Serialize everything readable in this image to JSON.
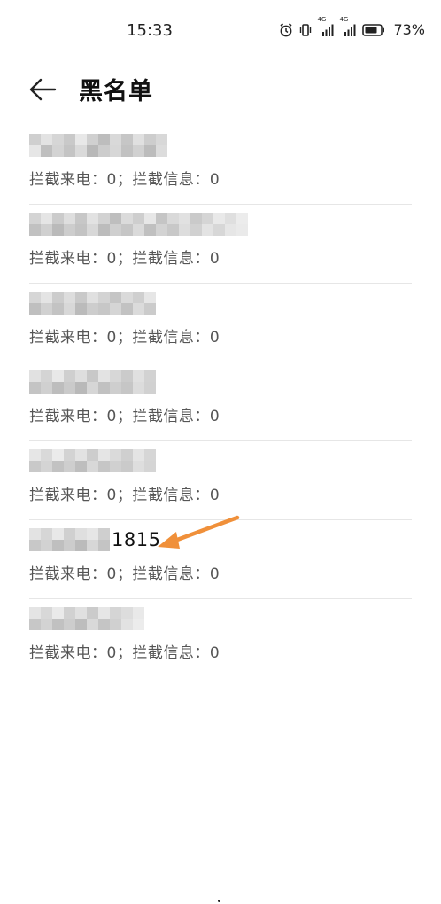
{
  "status_bar": {
    "time": "15:33",
    "network_1": "4G",
    "network_2": "4G",
    "battery": "73%",
    "icons": [
      "alarm-icon",
      "vibrate-icon",
      "signal-icon",
      "signal-icon",
      "battery-icon"
    ]
  },
  "header": {
    "back_icon": "back-arrow-icon",
    "title": "黑名单"
  },
  "blacklist": [
    {
      "visible_digits": "",
      "stats": "拦截来电：0；拦截信息：0"
    },
    {
      "visible_digits": "",
      "stats": "拦截来电：0；拦截信息：0"
    },
    {
      "visible_digits": "",
      "stats": "拦截来电：0；拦截信息：0"
    },
    {
      "visible_digits": "",
      "stats": "拦截来电：0；拦截信息：0"
    },
    {
      "visible_digits": "",
      "stats": "拦截来电：0；拦截信息：0"
    },
    {
      "visible_digits": "1815",
      "stats": "拦截来电：0；拦截信息：0"
    },
    {
      "visible_digits": "",
      "stats": "拦截来电：0；拦截信息：0"
    }
  ],
  "annotation": {
    "arrow_color": "#f0903a"
  }
}
